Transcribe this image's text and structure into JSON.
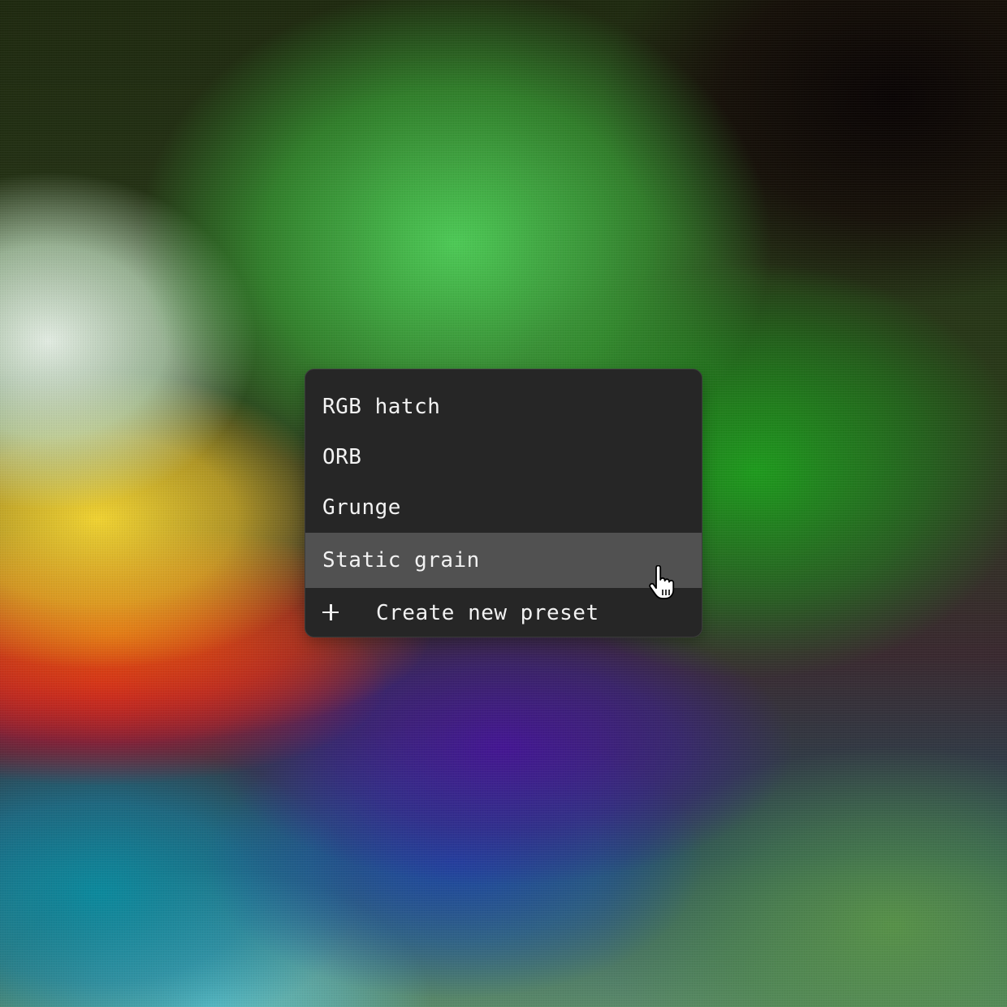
{
  "menu": {
    "items": [
      {
        "label": "RGB hatch",
        "highlighted": false
      },
      {
        "label": "ORB",
        "highlighted": false
      },
      {
        "label": "Grunge",
        "highlighted": false
      },
      {
        "label": "Static grain",
        "highlighted": true
      }
    ],
    "create_label": "Create new preset",
    "create_icon": "plus-icon"
  },
  "cursor": {
    "icon": "hand-pointer-icon"
  },
  "colors": {
    "menu_background": "#262626",
    "menu_highlight": "#515151",
    "menu_text": "#f2f2f2"
  }
}
